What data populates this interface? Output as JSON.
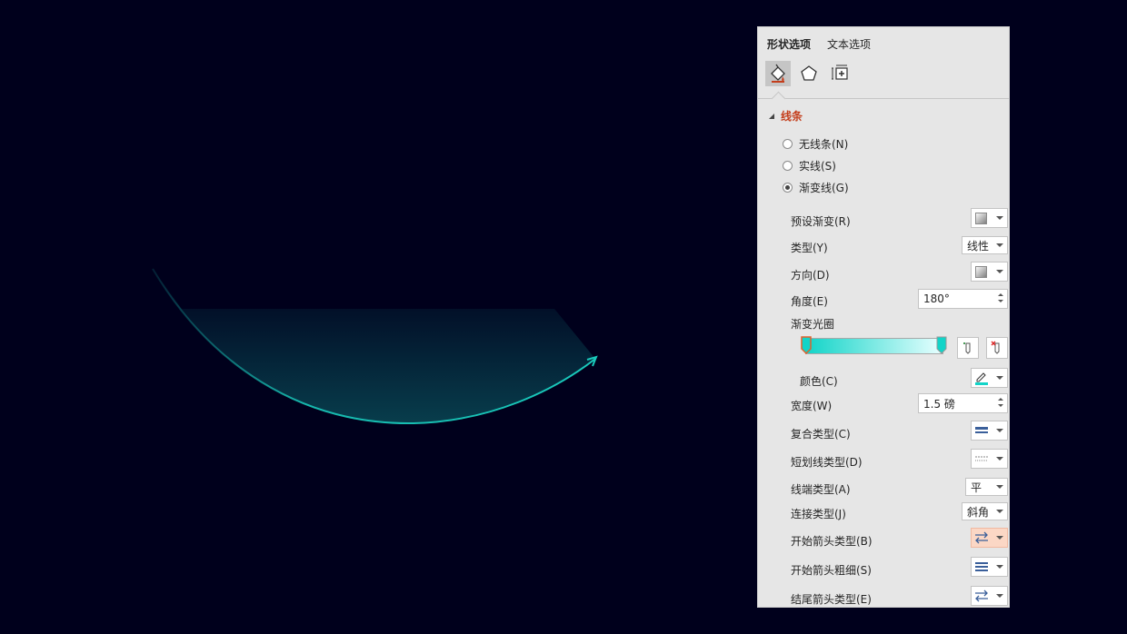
{
  "canvas": {
    "background": "#00001c",
    "arc_color": "#19c9bb",
    "glow_color": "#0e6f73"
  },
  "panel": {
    "tabs": [
      {
        "label": "形状选项",
        "active": true
      },
      {
        "label": "文本选项",
        "active": false
      }
    ],
    "icon_tabs": [
      "fill-line-icon",
      "effects-pentagon-icon",
      "size-properties-icon"
    ],
    "section": {
      "title": "线条",
      "expanded": true
    },
    "line_options": [
      {
        "label": "无线条(N)",
        "checked": false
      },
      {
        "label": "实线(S)",
        "checked": false
      },
      {
        "label": "渐变线(G)",
        "checked": true
      }
    ],
    "props": {
      "preset": {
        "label": "预设渐变(R)"
      },
      "type": {
        "label": "类型(Y)",
        "value": "线性"
      },
      "direction": {
        "label": "方向(D)"
      },
      "angle": {
        "label": "角度(E)",
        "value": "180°"
      },
      "stops": {
        "label": "渐变光圈",
        "colors": [
          "#12d4c8",
          "#e8ffff"
        ],
        "add_icon": "add-stop-icon",
        "remove_icon": "remove-stop-icon"
      },
      "color": {
        "label": "颜色(C)",
        "swatch": "#12d4c8"
      },
      "width": {
        "label": "宽度(W)",
        "value": "1.5 磅"
      },
      "compound": {
        "label": "复合类型(C)"
      },
      "dash": {
        "label": "短划线类型(D)"
      },
      "cap": {
        "label": "线端类型(A)",
        "value": "平"
      },
      "join": {
        "label": "连接类型(J)",
        "value": "斜角"
      },
      "begin_arrow": {
        "label": "开始箭头类型(B)"
      },
      "begin_size": {
        "label": "开始箭头粗细(S)"
      },
      "end_arrow": {
        "label": "结尾箭头类型(E)"
      }
    }
  }
}
